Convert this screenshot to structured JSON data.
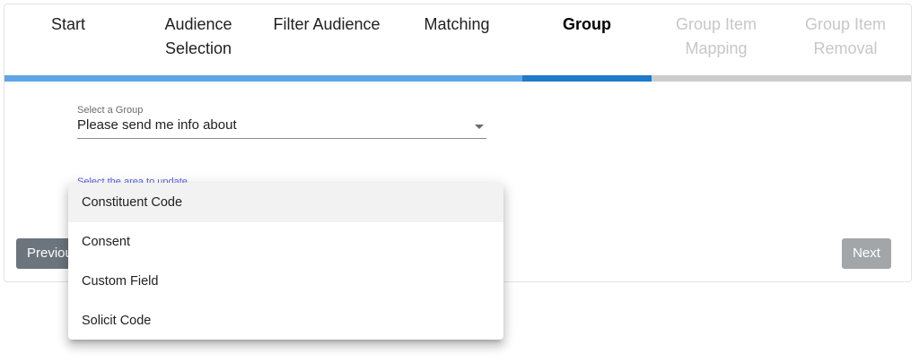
{
  "wizard": {
    "steps": [
      {
        "label": "Start",
        "state": "complete"
      },
      {
        "label": "Audience Selection",
        "state": "complete"
      },
      {
        "label": "Filter Audience",
        "state": "complete"
      },
      {
        "label": "Matching",
        "state": "complete"
      },
      {
        "label": "Group",
        "state": "active"
      },
      {
        "label": "Group Item Mapping",
        "state": "upcoming"
      },
      {
        "label": "Group Item Removal",
        "state": "upcoming"
      }
    ],
    "progress_colors": {
      "complete": "#5fa6e6",
      "active": "#1f7ac9",
      "upcoming": "#cccccc"
    }
  },
  "group_select": {
    "label": "Select a Group",
    "value": "Please send me info about"
  },
  "area_select": {
    "label": "Select the area to update",
    "options": [
      "Constituent Code",
      "Consent",
      "Custom Field",
      "Solicit Code"
    ],
    "highlighted_index": 0
  },
  "buttons": {
    "previous_label": "Previous",
    "next_label": "Next"
  }
}
